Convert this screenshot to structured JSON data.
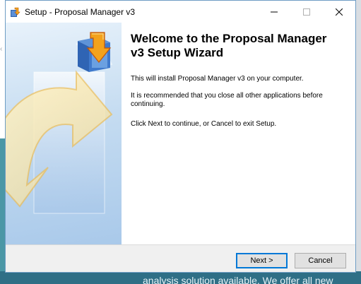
{
  "window": {
    "title": "Setup - Proposal Manager v3"
  },
  "wizard": {
    "heading": "Welcome to the Proposal Manager v3 Setup Wizard",
    "paragraphs": [
      "This will install Proposal Manager v3 on your computer.",
      "It is recommended that you close all other applications before continuing.",
      "Click Next to continue, or Cancel to exit Setup."
    ]
  },
  "buttons": {
    "next": "Next >",
    "cancel": "Cancel"
  },
  "background": {
    "bottom_text": "analysis solution available. We offer all new"
  },
  "icons": {
    "app": "installer-box-icon",
    "minimize": "minimize-icon",
    "maximize": "maximize-icon",
    "close": "close-icon"
  },
  "colors": {
    "accent": "#0078d7",
    "side_panel": "#a9c9ea",
    "background_teal": "#2f6f86"
  }
}
